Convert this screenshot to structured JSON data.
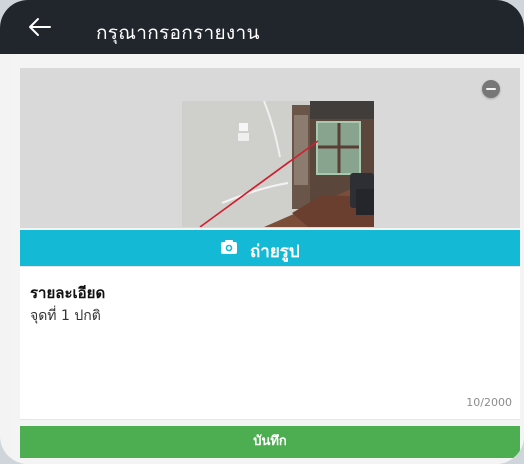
{
  "header": {
    "title": "กรุณากรอกรายงาน",
    "back_icon": "arrow-left"
  },
  "photo": {
    "remove_icon": "minus-circle",
    "camera_icon": "camera",
    "camera_label": "ถ่ายรูป"
  },
  "details": {
    "label": "รายละเอียด",
    "value": "จุดที่ 1 ปกติ",
    "counter": "10/2000"
  },
  "actions": {
    "save_label": "บันทึก"
  },
  "colors": {
    "appbar": "#20262c",
    "camera_bar": "#14b9d6",
    "save_button": "#4cae50"
  }
}
